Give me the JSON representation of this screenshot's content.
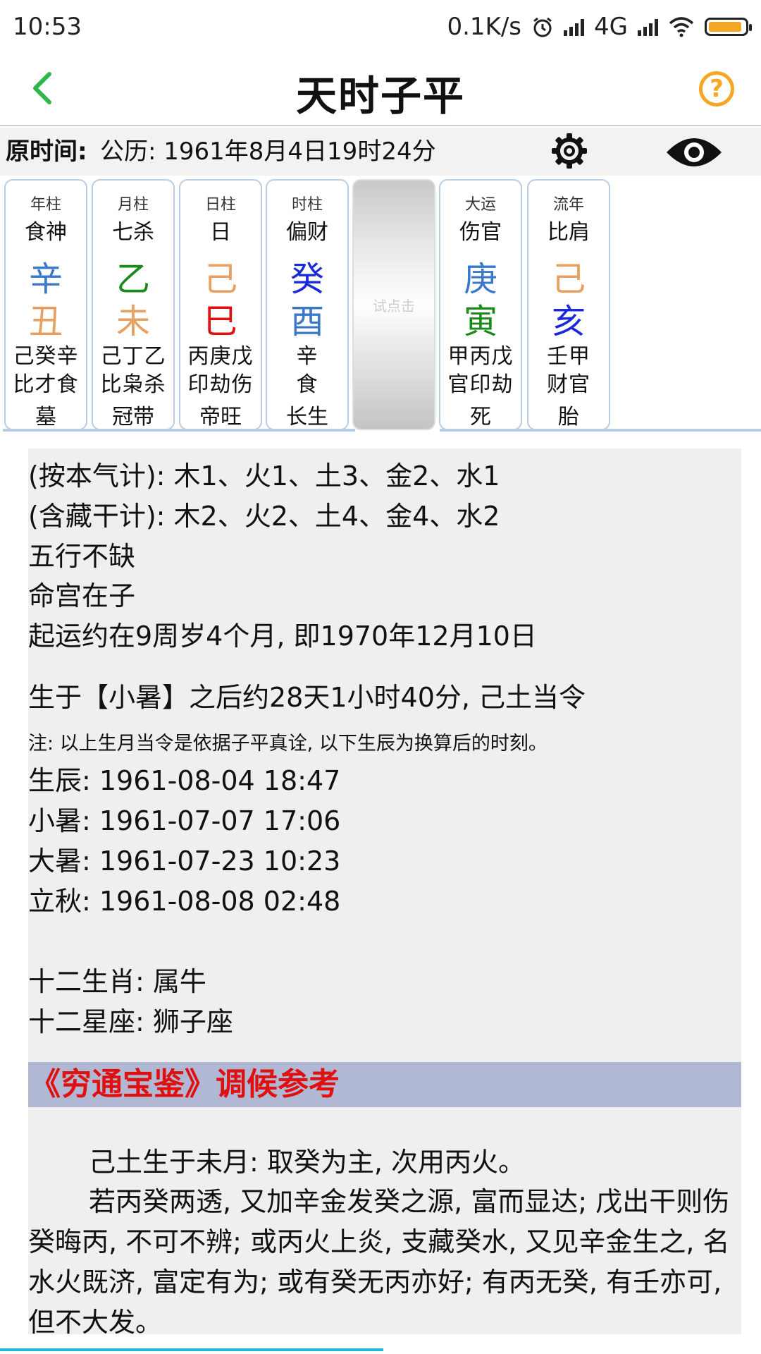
{
  "status": {
    "time": "10:53",
    "net_speed": "0.1K/s",
    "network": "4G",
    "battery_level": 0.92,
    "battery_color": "#f5a623"
  },
  "header": {
    "title": "天时子平",
    "back_icon": "chevron-left-icon",
    "help_icon": "help-circle-icon",
    "help_glyph": "?",
    "accent_back": "#2eb84a",
    "accent_help": "#f5a623"
  },
  "time_row": {
    "label": "原时间:",
    "value": "公历: 1961年8月4日19时24分",
    "settings_icon": "gear-icon",
    "visibility_icon": "eye-icon"
  },
  "pillars": [
    {
      "label": "年柱",
      "god": "食神",
      "stem": "辛",
      "stem_color": "#3a78c8",
      "branch": "丑",
      "branch_color": "#e8a060",
      "hidden": "己癸辛",
      "hidden_gods": "比才食",
      "stage": "墓"
    },
    {
      "label": "月柱",
      "god": "七杀",
      "stem": "乙",
      "stem_color": "#1a8a1a",
      "branch": "未",
      "branch_color": "#e8a060",
      "hidden": "己丁乙",
      "hidden_gods": "比枭杀",
      "stage": "冠带"
    },
    {
      "label": "日柱",
      "god": "日",
      "stem": "己",
      "stem_color": "#e8a060",
      "branch": "巳",
      "branch_color": "#e01010",
      "hidden": "丙庚戊",
      "hidden_gods": "印劫伤",
      "stage": "帝旺"
    },
    {
      "label": "时柱",
      "god": "偏财",
      "stem": "癸",
      "stem_color": "#1a2ad8",
      "branch": "酉",
      "branch_color": "#3a78c8",
      "hidden": "辛",
      "hidden_gods": "食",
      "stage": "长生"
    }
  ],
  "tap_hint": "试点击",
  "luck_pillars": [
    {
      "label": "大运",
      "god": "伤官",
      "stem": "庚",
      "stem_color": "#3a78c8",
      "branch": "寅",
      "branch_color": "#1a8a1a",
      "hidden": "甲丙戊",
      "hidden_gods": "官印劫",
      "stage": "死"
    },
    {
      "label": "流年",
      "god": "比肩",
      "stem": "己",
      "stem_color": "#e8a060",
      "branch": "亥",
      "branch_color": "#1a2ad8",
      "hidden": "壬甲",
      "hidden_gods": "财官",
      "stage": "胎"
    }
  ],
  "info": {
    "lines_a": [
      "(按本气计): 木1、火1、土3、金2、水1",
      "(含藏干计): 木2、火2、土4、金4、水2",
      "五行不缺",
      "命宫在子",
      "起运约在9周岁4个月, 即1970年12月10日"
    ],
    "solar_term": "生于【小暑】之后约28天1小时40分, 己土当令",
    "note": "注: 以上生月当令是依据子平真诠, 以下生辰为换算后的时刻。",
    "lines_b": [
      "生辰: 1961-08-04 18:47",
      "小暑: 1961-07-07 17:06",
      "大暑: 1961-07-23 10:23",
      "立秋: 1961-08-08 02:48"
    ],
    "zodiac": "十二生肖: 属牛",
    "constellation": "十二星座: 狮子座"
  },
  "reference": {
    "header": "《穷通宝鉴》调候参考",
    "para1": "己土生于未月: 取癸为主, 次用丙火。",
    "para2": "若丙癸两透, 又加辛金发癸之源, 富而显达; 戊出干则伤癸晦丙, 不可不辨; 或丙火上炎, 支藏癸水, 又见辛金生之, 名水火既济, 富定有为; 或有癸无丙亦好; 有丙无癸, 有壬亦可, 但不大发。"
  }
}
